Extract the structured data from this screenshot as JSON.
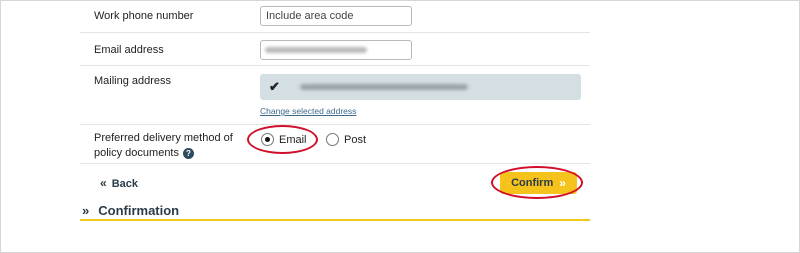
{
  "form": {
    "work_phone": {
      "label": "Work phone number",
      "placeholder": "Include area code"
    },
    "email": {
      "label": "Email address"
    },
    "mailing_address": {
      "label": "Mailing address",
      "change_link": "Change selected address"
    },
    "delivery_method": {
      "label_line1": "Preferred delivery method of",
      "label_line2": "policy documents",
      "help_icon": "?",
      "options": [
        {
          "label": "Email",
          "selected": true
        },
        {
          "label": "Post",
          "selected": false
        }
      ]
    }
  },
  "nav": {
    "back_chevron": "«",
    "back_label": "Back",
    "confirm_label": "Confirm",
    "confirm_chevron": "»"
  },
  "section": {
    "chevron": "»",
    "title": "Confirmation"
  },
  "colors": {
    "accent_yellow": "#f6c21c",
    "annotation_red": "#d0102b",
    "link_blue": "#3e6a8a",
    "address_bg": "#d3dfe3"
  }
}
